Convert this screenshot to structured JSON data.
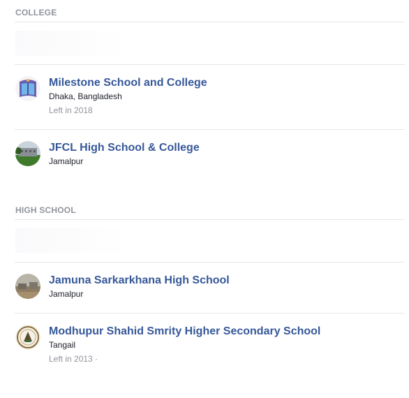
{
  "sections": {
    "college": {
      "heading": "COLLEGE",
      "entries": [
        {
          "name": "Milestone School and College",
          "location": "Dhaka, Bangladesh",
          "status": "Left in 2018",
          "thumb_icon": "book-emblem-icon"
        },
        {
          "name": "JFCL High School & College",
          "location": "Jamalpur",
          "thumb_icon": "campus-photo-icon"
        }
      ]
    },
    "high_school": {
      "heading": "HIGH SCHOOL",
      "entries": [
        {
          "name": "Jamuna Sarkarkhana High School",
          "location": "Jamalpur",
          "thumb_icon": "landscape-photo-icon"
        },
        {
          "name": "Modhupur Shahid Smrity Higher Secondary School",
          "location": "Tangail",
          "status": "Left in 2013 ·",
          "thumb_icon": "school-emblem-icon"
        }
      ]
    }
  },
  "colors": {
    "link": "#365899",
    "muted": "#90949c",
    "text": "#1d2129",
    "divider": "#e5e6e9"
  }
}
